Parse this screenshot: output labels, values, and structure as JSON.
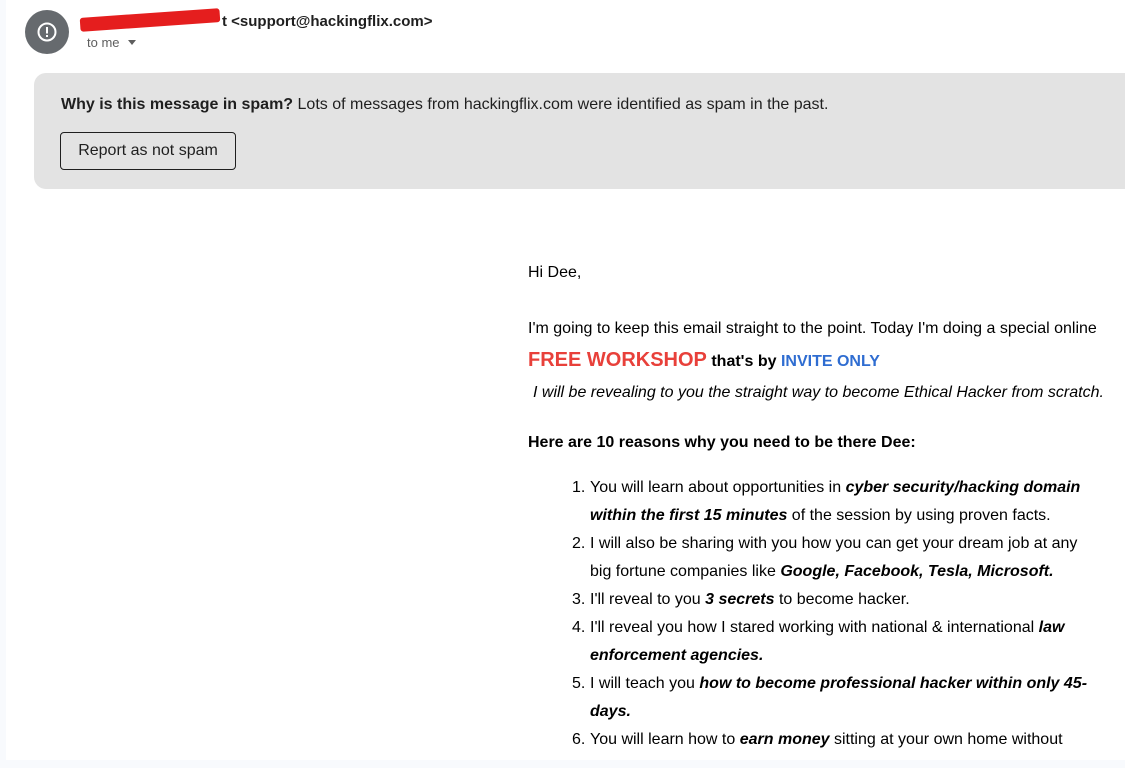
{
  "header": {
    "sender_suffix": "t",
    "sender_email": "<support@hackingflix.com>",
    "recipient_label": "to me",
    "avatar_icon": "alert-circle-icon"
  },
  "spam_banner": {
    "question": "Why is this message in spam?",
    "reason": "Lots of messages from hackingflix.com were identified as spam in the past.",
    "button_label": "Report as not spam"
  },
  "email": {
    "greeting": "Hi Dee,",
    "intro": "I'm going to keep this email straight to the point. Today I'm doing a special online",
    "free_workshop": "FREE WORKSHOP",
    "thats_by": " that's by ",
    "invite_only": "INVITE ONLY",
    "reveal_line": "I will be revealing to you the straight way to become Ethical Hacker from scratch.",
    "reasons_heading": "Here are 10 reasons why you need to be there Dee:",
    "reasons": [
      {
        "num": "1.",
        "a": "You will learn about opportunities in ",
        "b": "cyber security/hacking domain within the first 15 minutes",
        "c": " of the session by using proven facts."
      },
      {
        "num": "2.",
        "a": "I will also be sharing with you how you can get your dream job at any big fortune companies like ",
        "b": "Google, Facebook, Tesla, Microsoft.",
        "c": ""
      },
      {
        "num": "3.",
        "a": "I'll reveal to you ",
        "b": "3 secrets",
        "c": " to become hacker."
      },
      {
        "num": "4.",
        "a": "I'll reveal you how I stared working with national & international ",
        "b": "law enforcement agencies.",
        "c": ""
      },
      {
        "num": "5.",
        "a": "I will teach you ",
        "b": "how to become professional hacker within only 45-days.",
        "c": ""
      },
      {
        "num": "6.",
        "a": "You will learn how to ",
        "b": "earn money",
        "c": " sitting at your own home without doing"
      }
    ]
  },
  "colors": {
    "free_workshop": "#e8403a",
    "invite_only": "#2f6dd1",
    "banner_bg": "#e3e3e3",
    "avatar_bg": "#666a6e",
    "redaction": "#e51e1e"
  }
}
